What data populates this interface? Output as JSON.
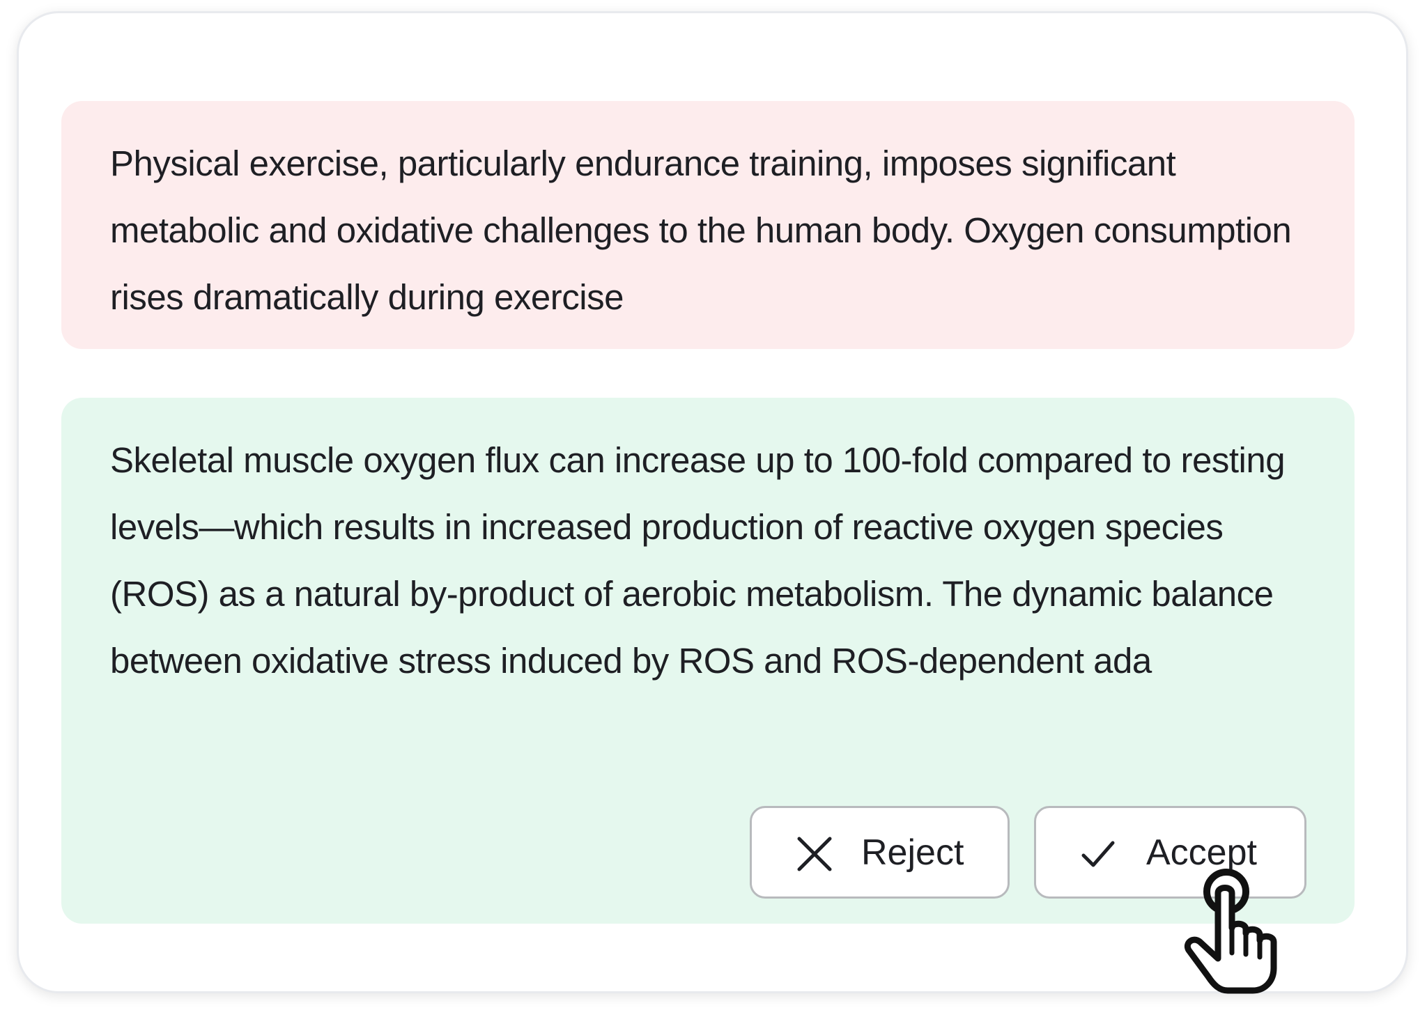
{
  "removed_suggestion": {
    "text": "Physical exercise, particularly endurance training, imposes significant metabolic and oxidative challenges to the human body. Oxygen consumption rises dramatically during exercise",
    "background_color": "#fdeced"
  },
  "added_suggestion": {
    "text": "Skeletal muscle oxygen flux can increase up to 100-fold compared to resting levels—which results in increased production of reactive oxygen species (ROS) as a natural by-product of aerobic metabolism. The dynamic balance between oxidative stress induced by ROS and ROS-dependent ada",
    "background_color": "#e5f8ee"
  },
  "actions": {
    "reject_label": "Reject",
    "reject_icon": "close-icon",
    "accept_label": "Accept",
    "accept_icon": "check-icon"
  },
  "pointer": {
    "icon": "hand-pointer-icon"
  }
}
